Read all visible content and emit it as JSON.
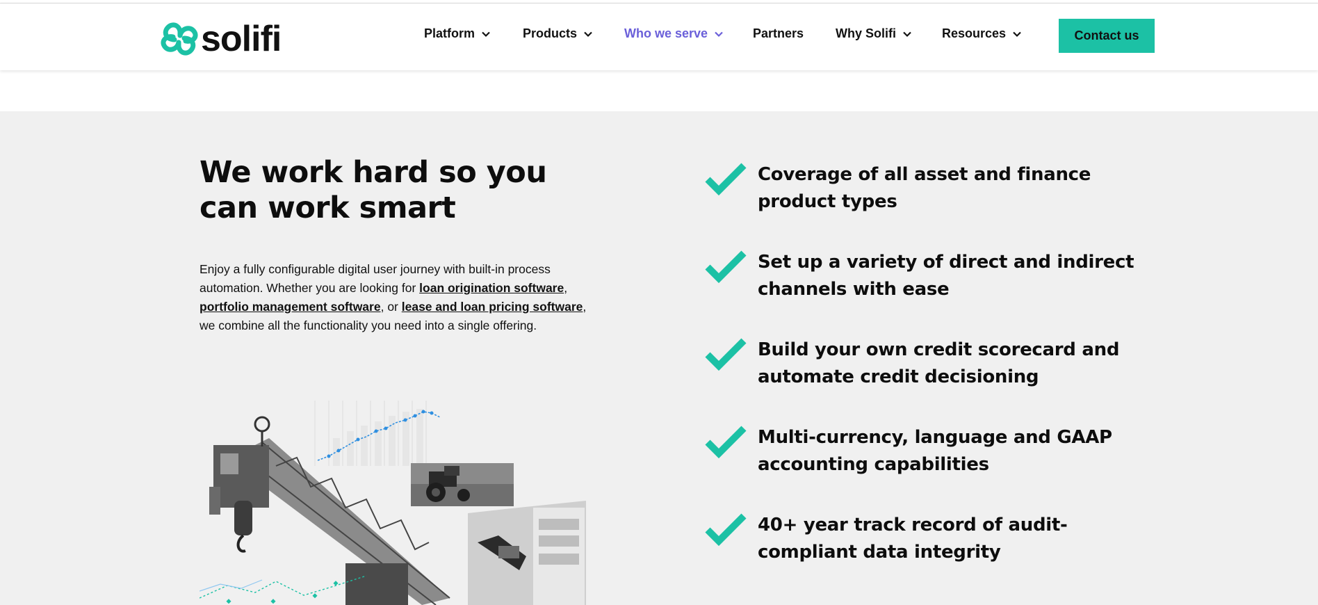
{
  "header": {
    "logo_text": "solifi",
    "nav": [
      {
        "label": "Platform",
        "has_dropdown": true
      },
      {
        "label": "Products",
        "has_dropdown": true
      },
      {
        "label": "Who we serve",
        "has_dropdown": true,
        "active": true
      },
      {
        "label": "Partners",
        "has_dropdown": false
      },
      {
        "label": "Why Solifi",
        "has_dropdown": true
      },
      {
        "label": "Resources",
        "has_dropdown": true
      }
    ],
    "cta_label": "Contact us"
  },
  "section": {
    "heading": "We work hard so you can work smart",
    "paragraph": {
      "text_1": "Enjoy a fully configurable digital user journey with built-in process automation. Whether you are looking for ",
      "link_1": "loan origination software",
      "text_2": ", ",
      "link_2": "portfolio management software",
      "text_3": ", or ",
      "link_3": "lease and loan pricing software",
      "text_4": ", we combine all the functionality you need into a single offering."
    },
    "features": [
      {
        "text": "Coverage of all asset and finance product types",
        "icon": "checkmark-icon"
      },
      {
        "text": "Set up a variety of direct and indirect channels with ease",
        "icon": "checkmark-icon"
      },
      {
        "text": "Build your own credit scorecard and automate credit decisioning",
        "icon": "checkmark-icon"
      },
      {
        "text": "Multi-currency, language and GAAP accounting capabilities",
        "icon": "checkmark-icon"
      },
      {
        "text": "40+ year track record of audit-compliant data integrity",
        "icon": "checkmark-icon"
      }
    ]
  },
  "colors": {
    "brand_teal": "#1cc1a5",
    "active_nav": "#6a5fd9",
    "section_bg": "#f0f0f0",
    "chart_blue": "#2f8fe0"
  }
}
